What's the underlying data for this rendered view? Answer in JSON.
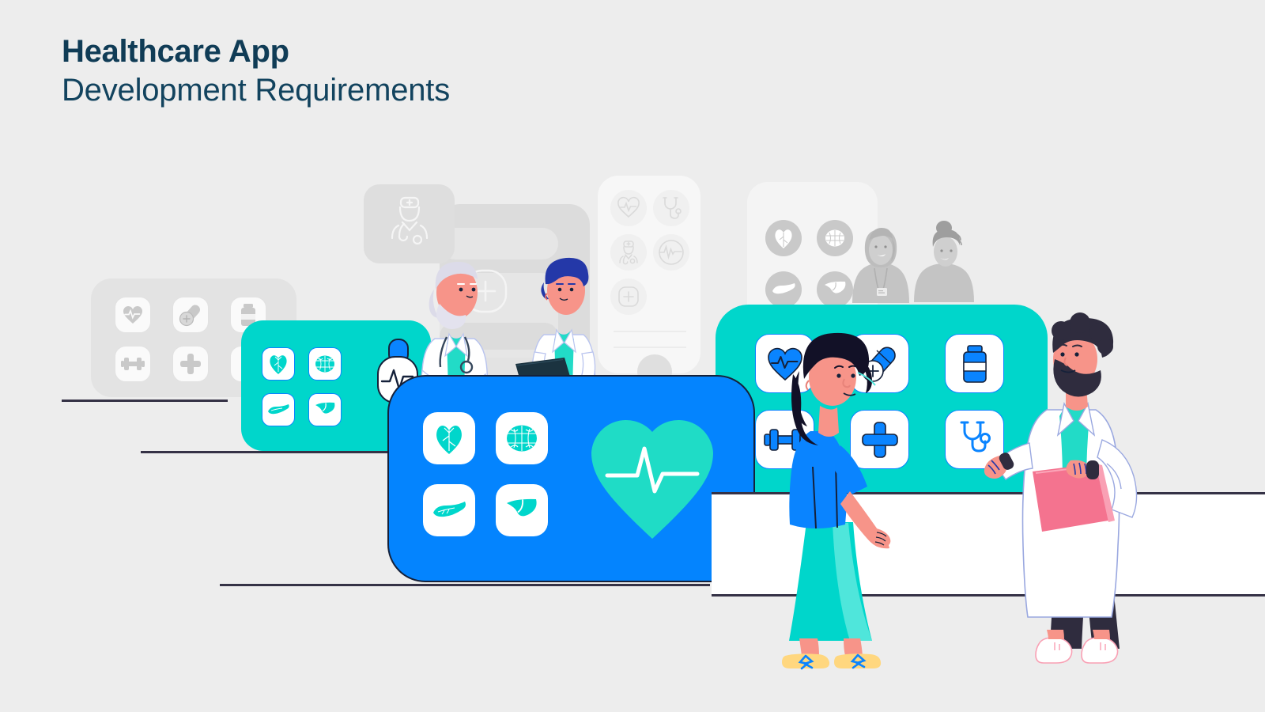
{
  "heading": {
    "line1": "Healthcare App",
    "line2": "Development Requirements"
  },
  "colors": {
    "background": "#ededed",
    "title_bold": "#103c56",
    "title_light": "#12435e",
    "blue": "#0484fe",
    "teal": "#00d6cb",
    "teal_light": "#3fe3d8",
    "white": "#ffffff",
    "gray_card": "#e3e3e3",
    "gray_icon": "#c9c9c9",
    "ground_line": "#353246",
    "skin": "#f79489",
    "skin_light": "#f9a9a0",
    "hair_dark": "#121127",
    "hair_blue": "#2438a8",
    "hair_white": "#d8d7e6",
    "pink_folder": "#f4738f",
    "shoe_yellow": "#ffd77f",
    "pants_dark": "#2f2c3e"
  },
  "cards": {
    "gray_left": {
      "name": "gray-icon-card-left",
      "icons": [
        "heartbeat-icon",
        "capsule-pill-icon",
        "medicine-bottle-icon",
        "dumbbell-icon",
        "medical-cross-icon",
        "medicine-bottle-icon"
      ]
    },
    "teal_left": {
      "name": "teal-organ-card",
      "icons": [
        "heart-organ-icon",
        "brain-icon",
        "pancreas-icon",
        "liver-icon"
      ]
    },
    "blue_main": {
      "name": "blue-feature-card",
      "icons": [
        "heart-organ-icon",
        "brain-icon",
        "pancreas-icon",
        "liver-icon"
      ],
      "hero_icon": "heart-pulse-icon"
    },
    "teal_right": {
      "name": "teal-icon-card-right",
      "icons": [
        "heartbeat-icon",
        "capsule-pill-icon",
        "medicine-bottle-icon",
        "dumbbell-icon",
        "medical-cross-icon",
        "stethoscope-icon"
      ]
    },
    "white_center": {
      "name": "white-app-panel",
      "icons": [
        "heartbeat-outline-icon",
        "stethoscope-outline-icon",
        "doctor-outline-icon",
        "pulse-circle-outline-icon",
        "plus-outline-icon"
      ]
    },
    "gray_right": {
      "name": "gray-organ-card-right",
      "icons": [
        "heart-organ-icon",
        "brain-icon",
        "pancreas-icon",
        "liver-icon"
      ]
    },
    "gray_back_mid": {
      "name": "gray-background-panel",
      "icons": [
        "doctor-badge-icon",
        "plus-circle-icon"
      ]
    }
  },
  "characters": [
    {
      "name": "elderly-doctor",
      "description": "Senior doctor with white hair and beard, arms crossed, stethoscope"
    },
    {
      "name": "young-doctor-clipboard",
      "description": "Doctor with blue hair holding dark clipboard"
    },
    {
      "name": "patient-woman",
      "description": "Woman with black hair, blue top, teal skirt, yellow sneakers"
    },
    {
      "name": "bearded-doctor",
      "description": "Bearded doctor in white coat holding pink folder"
    },
    {
      "name": "background-nurse",
      "description": "Gray silhouette nurse with ID badge"
    },
    {
      "name": "background-person",
      "description": "Gray silhouette person with top bun"
    }
  ]
}
